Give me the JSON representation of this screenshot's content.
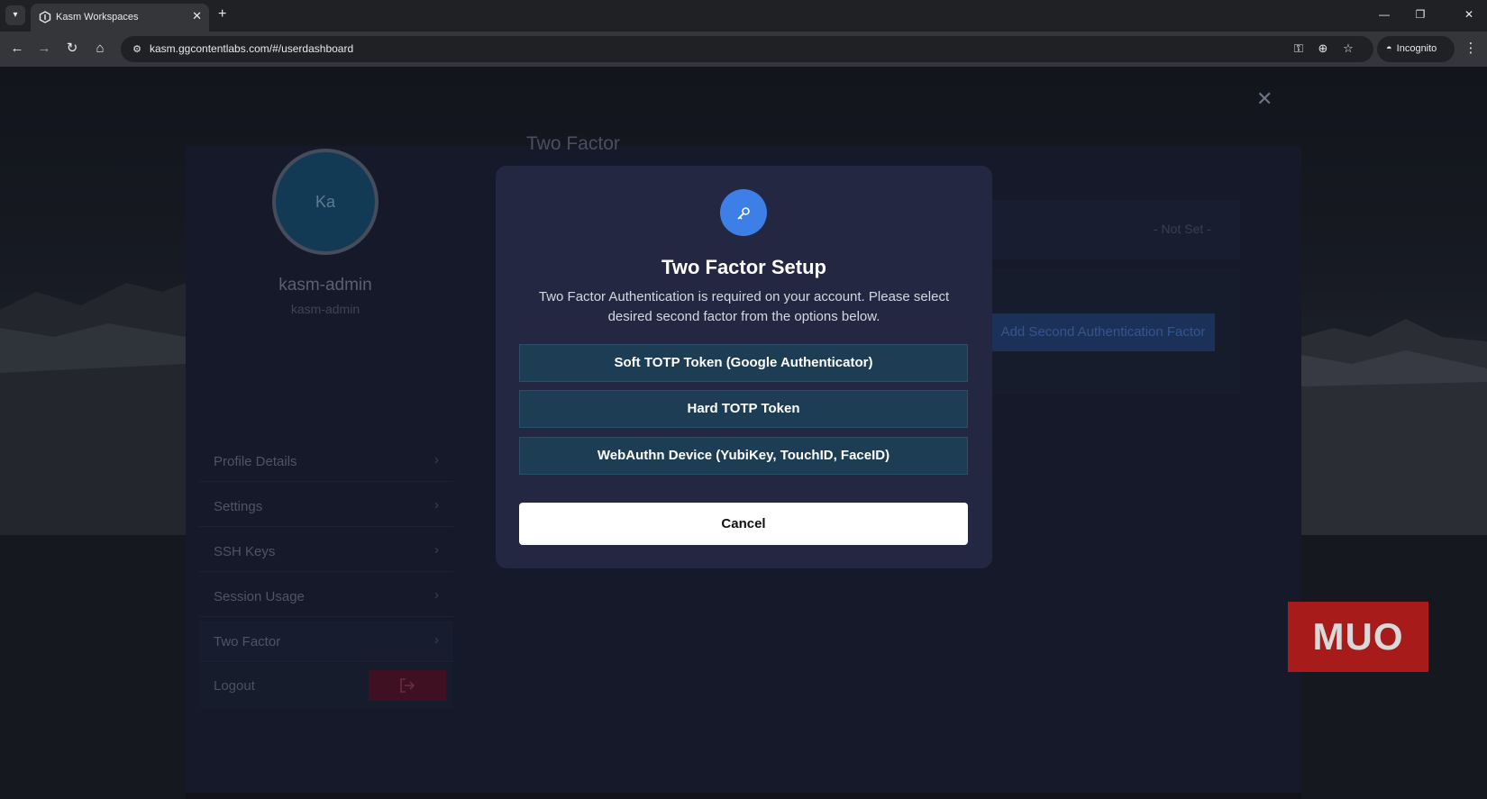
{
  "browser": {
    "tab_search_icon": "chevron-down-icon",
    "tab_title": "Kasm Workspaces",
    "tab_close": "✕",
    "new_tab": "+",
    "window_controls": {
      "minimize": "—",
      "restore": "❐",
      "close": "✕"
    },
    "url": "kasm.ggcontentlabs.com/#/userdashboard",
    "incognito_label": "Incognito"
  },
  "profile": {
    "avatar_initials": "Ka",
    "username": "kasm-admin",
    "username_sub": "kasm-admin"
  },
  "sidebar": {
    "items": [
      {
        "label": "Profile Details"
      },
      {
        "label": "Settings"
      },
      {
        "label": "SSH Keys"
      },
      {
        "label": "Session Usage"
      },
      {
        "label": "Two Factor"
      }
    ],
    "chevron": "›",
    "logout_label": "Logout",
    "logout_icon": "logout-icon"
  },
  "main": {
    "title": "Two Factor",
    "status": "- Not Set -",
    "add_factor_label": "Add Second Authentication Factor"
  },
  "modal": {
    "icon": "key-icon",
    "title": "Two Factor Setup",
    "description": "Two Factor Authentication is required on your account. Please select desired second factor from the options below.",
    "options": [
      {
        "label": "Soft TOTP Token (Google Authenticator)"
      },
      {
        "label": "Hard TOTP Token"
      },
      {
        "label": "WebAuthn Device (YubiKey, TouchID, FaceID)"
      }
    ],
    "cancel_label": "Cancel"
  },
  "watermark": {
    "text": "MUO"
  },
  "colors": {
    "modal_bg": "#232741",
    "option_bg": "#1d3d55",
    "icon_blue": "#3d7fe6",
    "watermark_red": "#a81b1b"
  }
}
